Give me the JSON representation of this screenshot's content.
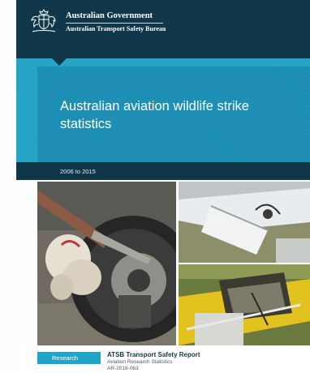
{
  "header": {
    "government": "Australian Government",
    "bureau": "Australian Transport Safety Bureau",
    "crest_icon": "coat-of-arms-icon"
  },
  "cover": {
    "title": "Australian aviation wildlife strike statistics",
    "years": "2006 to 2015"
  },
  "footer": {
    "category": "Research",
    "report_type": "ATSB Transport Safety Report",
    "series": "Aviation Research Statistics",
    "report_number": "AR-2016-063"
  },
  "colors": {
    "navy": "#10384a",
    "accent_blue": "#21a3c4",
    "dark_blue": "#1a8db3"
  }
}
